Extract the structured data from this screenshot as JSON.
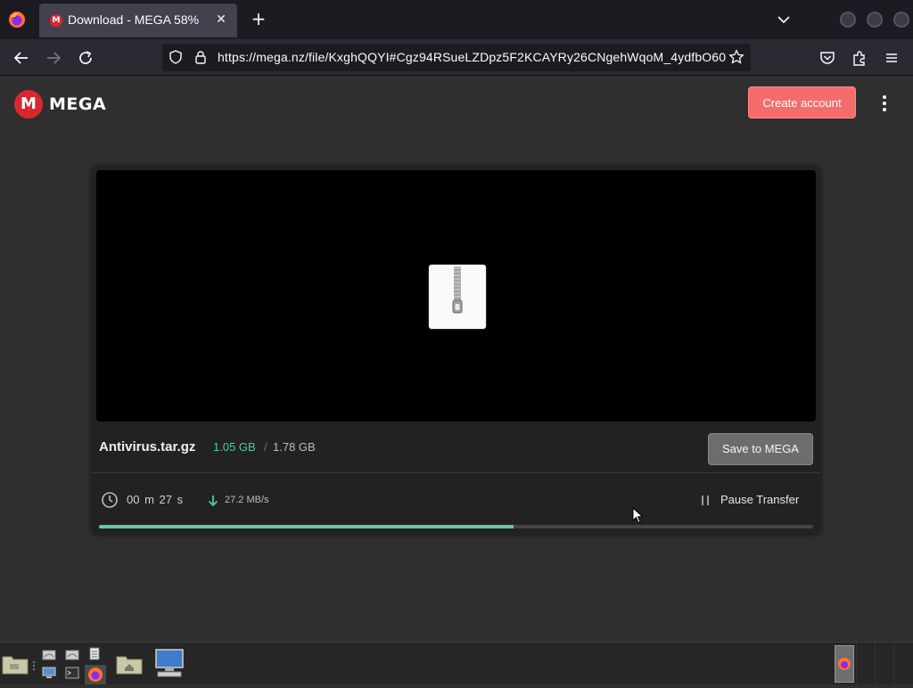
{
  "browser": {
    "tab_title": "Download - MEGA 58%",
    "tab_favicon": "M",
    "url": "https://mega.nz/file/KxghQQYI#Cgz94RSueLZDpz5F2KCAYRy26CNgehWqoM_4ydfbO60"
  },
  "header": {
    "logo_mark": "M",
    "logo_text": "MEGA",
    "create_account_label": "Create account"
  },
  "file": {
    "name": "Antivirus.tar.gz",
    "downloaded": "1.05 GB",
    "separator": "/",
    "total": "1.78 GB",
    "save_label": "Save to MEGA"
  },
  "transfer": {
    "time_remaining": "00 m  27 s",
    "speed": "27.2 MB/s",
    "pause_label": "Pause Transfer",
    "progress_percent": 58
  },
  "colors": {
    "brand_red": "#d9272e",
    "create_button": "#f46c6c",
    "progress_green": "#63c9a6",
    "downloaded_text": "#4fc8a5"
  }
}
